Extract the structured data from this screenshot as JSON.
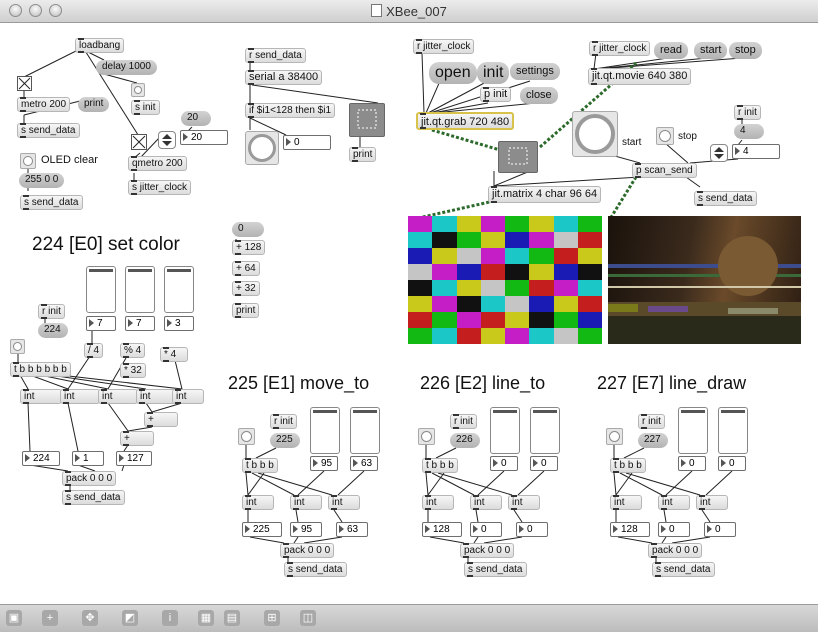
{
  "window": {
    "title": "XBee_007"
  },
  "objects": {
    "loadbang": "loadbang",
    "delay": "delay 1000",
    "metro": "metro 200",
    "print1": "print",
    "s_send1": "s send_data",
    "s_init": "s init",
    "oled": "OLED clear",
    "msg255": "255 0 0",
    "s_send2": "s send_data",
    "qmetro": "qmetro 200",
    "s_jitter": "s jitter_clock",
    "num20a": "20",
    "num20b": "20",
    "r_send_data": "r send_data",
    "serial": "serial a 38400",
    "ifexpr": "if $i1<128 then $i1",
    "num0a": "0",
    "print2": "print",
    "msg0": "0",
    "plus128": "+ 128",
    "plus64": "+ 64",
    "plus32": "+ 32",
    "print3": "print",
    "r_jitter1": "r jitter_clock",
    "open": "open",
    "init": "init",
    "settings": "settings",
    "p_init": "p init",
    "close": "close",
    "grab": "jit.qt.grab 720 480",
    "r_jitter2": "r jitter_clock",
    "read": "read",
    "start": "start",
    "stop": "stop",
    "movie": "jit.qt.movie 640 380",
    "start_label": "start",
    "stop_label": "stop",
    "r_init1": "r init",
    "num4a": "4",
    "num4b": "4",
    "scan_send": "p scan_send",
    "s_send3": "s send_data",
    "matrix": "jit.matrix 4 char 96 64"
  },
  "sections": {
    "set_color": {
      "heading": "224 [E0] set color",
      "r_init": "r init",
      "code": "224",
      "tbbbbbb": "t b b b b b b",
      "sliders": [
        "7",
        "7",
        "3"
      ],
      "ops": [
        "/ 4",
        "% 4",
        "* 32",
        "* 4",
        "+",
        "+"
      ],
      "ints": [
        "int",
        "int",
        "int",
        "int",
        "int"
      ],
      "outs": [
        "224",
        "1",
        "127"
      ],
      "pack": "pack 0 0 0",
      "send": "s send_data"
    },
    "move_to": {
      "heading": "225 [E1] move_to",
      "r_init": "r init",
      "code": "225",
      "tb": "t b b b",
      "sliders": [
        "95",
        "63"
      ],
      "ints": [
        "int",
        "int",
        "int"
      ],
      "outs": [
        "225",
        "95",
        "63"
      ],
      "pack": "pack 0 0 0",
      "send": "s send_data"
    },
    "line_to": {
      "heading": "226 [E2] line_to",
      "r_init": "r init",
      "code": "226",
      "tb": "t b b b",
      "sliders": [
        "0",
        "0"
      ],
      "ints": [
        "int",
        "int",
        "int"
      ],
      "outs": [
        "128",
        "0",
        "0"
      ],
      "pack": "pack 0 0 0",
      "send": "s send_data"
    },
    "line_draw": {
      "heading": "227 [E7] line_draw",
      "r_init": "r init",
      "code": "227",
      "tb": "t b b b",
      "sliders": [
        "0",
        "0"
      ],
      "ints": [
        "int",
        "int",
        "int"
      ],
      "outs": [
        "128",
        "0",
        "0"
      ],
      "pack": "pack 0 0 0",
      "send": "s send_data"
    }
  },
  "matrix_colors": [
    [
      "#c61ec6",
      "#1bc7c7",
      "#c9c91c",
      "#c61ec6",
      "#12b912",
      "#c9c91c",
      "#1bc7c7",
      "#12b912"
    ],
    [
      "#1bc7c7",
      "#111111",
      "#12b912",
      "#c9c91c",
      "#1a1ab5",
      "#c61ec6",
      "#c5c5c5",
      "#c41e1e"
    ],
    [
      "#1a1ab5",
      "#c9c91c",
      "#c5c5c5",
      "#c61ec6",
      "#1bc7c7",
      "#12b912",
      "#c41e1e",
      "#c9c91c"
    ],
    [
      "#c5c5c5",
      "#c61ec6",
      "#1a1ab5",
      "#c41e1e",
      "#111111",
      "#c9c91c",
      "#1a1ab5",
      "#111111"
    ],
    [
      "#111111",
      "#1bc7c7",
      "#c9c91c",
      "#c5c5c5",
      "#12b912",
      "#c41e1e",
      "#c61ec6",
      "#1bc7c7"
    ],
    [
      "#c9c91c",
      "#c61ec6",
      "#111111",
      "#1bc7c7",
      "#c5c5c5",
      "#1a1ab5",
      "#c9c91c",
      "#c41e1e"
    ],
    [
      "#c41e1e",
      "#12b912",
      "#c61ec6",
      "#c41e1e",
      "#c9c91c",
      "#111111",
      "#12b912",
      "#1a1ab5"
    ],
    [
      "#12b912",
      "#1bc7c7",
      "#c41e1e",
      "#c9c91c",
      "#c61ec6",
      "#1bc7c7",
      "#c5c5c5",
      "#12b912"
    ]
  ],
  "toolbar": {
    "icons": [
      "lock-icon",
      "add-object-icon",
      "move-icon",
      "presentation-icon",
      "info-icon",
      "grid-icon",
      "layers-icon",
      "snap-icon",
      "split-icon"
    ]
  }
}
